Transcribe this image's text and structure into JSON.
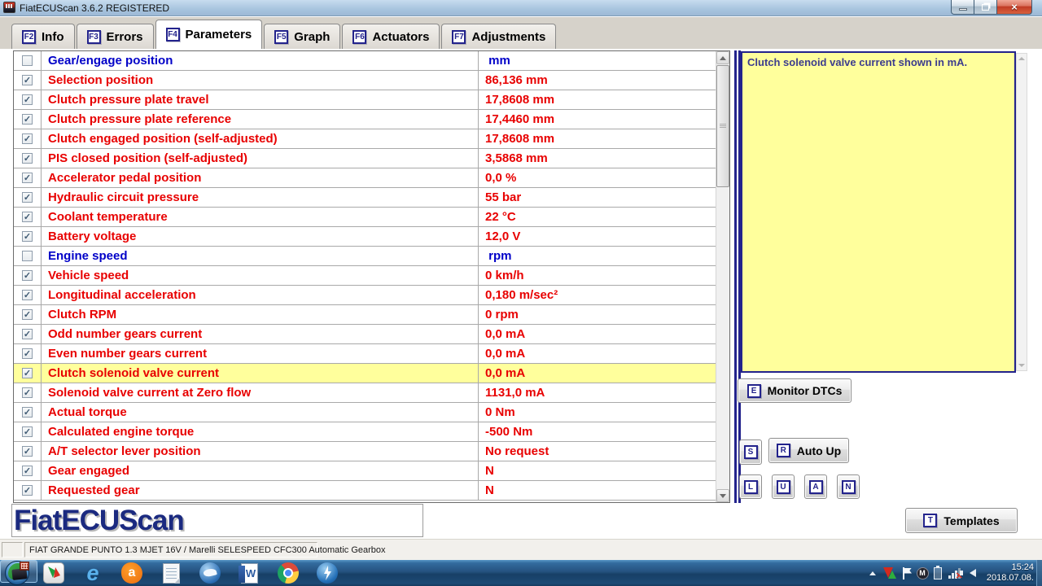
{
  "window": {
    "title": "FiatECUScan 3.6.2 REGISTERED",
    "controls": [
      "minimize-button",
      "maximize-restore-button",
      "close-button"
    ]
  },
  "tabs": [
    {
      "key": "F2",
      "label": "Info",
      "active": false
    },
    {
      "key": "F3",
      "label": "Errors",
      "active": false
    },
    {
      "key": "F4",
      "label": "Parameters",
      "active": true
    },
    {
      "key": "F5",
      "label": "Graph",
      "active": false
    },
    {
      "key": "F6",
      "label": "Actuators",
      "active": false
    },
    {
      "key": "F7",
      "label": "Adjustments",
      "active": false
    }
  ],
  "table": {
    "rows": [
      {
        "name": "Gear/engage position",
        "value": " mm",
        "checked": false,
        "highlighted": false
      },
      {
        "name": "Selection position",
        "value": "86,136 mm",
        "checked": true,
        "highlighted": false
      },
      {
        "name": "Clutch pressure plate travel",
        "value": "17,8608 mm",
        "checked": true,
        "highlighted": false
      },
      {
        "name": "Clutch pressure plate reference",
        "value": "17,4460 mm",
        "checked": true,
        "highlighted": false
      },
      {
        "name": "Clutch engaged position (self-adjusted)",
        "value": "17,8608 mm",
        "checked": true,
        "highlighted": false
      },
      {
        "name": "PIS closed position (self-adjusted)",
        "value": "3,5868 mm",
        "checked": true,
        "highlighted": false
      },
      {
        "name": "Accelerator pedal position",
        "value": "0,0 %",
        "checked": true,
        "highlighted": false
      },
      {
        "name": "Hydraulic circuit pressure",
        "value": "55 bar",
        "checked": true,
        "highlighted": false
      },
      {
        "name": "Coolant temperature",
        "value": "22 °C",
        "checked": true,
        "highlighted": false
      },
      {
        "name": "Battery voltage",
        "value": "12,0 V",
        "checked": true,
        "highlighted": false
      },
      {
        "name": "Engine speed",
        "value": " rpm",
        "checked": false,
        "highlighted": false
      },
      {
        "name": "Vehicle speed",
        "value": "0 km/h",
        "checked": true,
        "highlighted": false
      },
      {
        "name": "Longitudinal acceleration",
        "value": "0,180 m/sec²",
        "checked": true,
        "highlighted": false
      },
      {
        "name": "Clutch RPM",
        "value": "0 rpm",
        "checked": true,
        "highlighted": false
      },
      {
        "name": "Odd number gears current",
        "value": "0,0 mA",
        "checked": true,
        "highlighted": false
      },
      {
        "name": "Even number gears current",
        "value": "0,0 mA",
        "checked": true,
        "highlighted": false
      },
      {
        "name": "Clutch solenoid valve current",
        "value": "0,0 mA",
        "checked": true,
        "highlighted": true
      },
      {
        "name": "Solenoid valve current at Zero flow",
        "value": "1131,0 mA",
        "checked": true,
        "highlighted": false
      },
      {
        "name": "Actual torque",
        "value": "0 Nm",
        "checked": true,
        "highlighted": false
      },
      {
        "name": "Calculated engine torque",
        "value": "-500 Nm",
        "checked": true,
        "highlighted": false
      },
      {
        "name": "A/T selector lever position",
        "value": "No request",
        "checked": true,
        "highlighted": false
      },
      {
        "name": "Gear engaged",
        "value": "N",
        "checked": true,
        "highlighted": false
      },
      {
        "name": "Requested gear",
        "value": "N",
        "checked": true,
        "highlighted": false
      }
    ]
  },
  "info_panel": {
    "text": "Clutch solenoid valve current shown in mA."
  },
  "right_panel": {
    "monitor_dtcs": {
      "key": "E",
      "label": "Monitor DTCs"
    },
    "s_button": {
      "key": "S"
    },
    "auto_up": {
      "key": "R",
      "label": "Auto Up"
    },
    "key_buttons": [
      {
        "key": "L"
      },
      {
        "key": "U"
      },
      {
        "key": "A"
      },
      {
        "key": "N"
      }
    ]
  },
  "logo": {
    "text": "FiatECUScan"
  },
  "templates_button": {
    "key": "T",
    "label": "Templates"
  },
  "status_bar": {
    "text": "FIAT GRANDE PUNTO 1.3 MJET 16V / Marelli SELESPEED CFC300 Automatic Gearbox"
  },
  "taskbar": {
    "icons": [
      "start-button",
      "idm",
      "internet-explorer",
      "avast",
      "notepad",
      "thunderbird",
      "word",
      "chrome",
      "daemon-tools",
      "fiatecuscan"
    ],
    "active_icon": "fiatecuscan",
    "ie_glyph": "e",
    "avast_glyph": "a",
    "word_glyph": "W",
    "m_tray_glyph": "M",
    "tray_icons": [
      "show-hidden-icons",
      "avg",
      "action-center-flag",
      "m-tray",
      "battery",
      "network-disconnected",
      "volume"
    ],
    "clock": {
      "time": "15:24",
      "date": "2018.07.08."
    }
  },
  "colors": {
    "value_red": "#e80000",
    "unchecked_blue": "#0000c8",
    "highlight_yellow": "#ffff9c",
    "panel_navy": "#23238c",
    "info_text": "#3c3c8e",
    "logo_blue": "#1b2a80"
  }
}
